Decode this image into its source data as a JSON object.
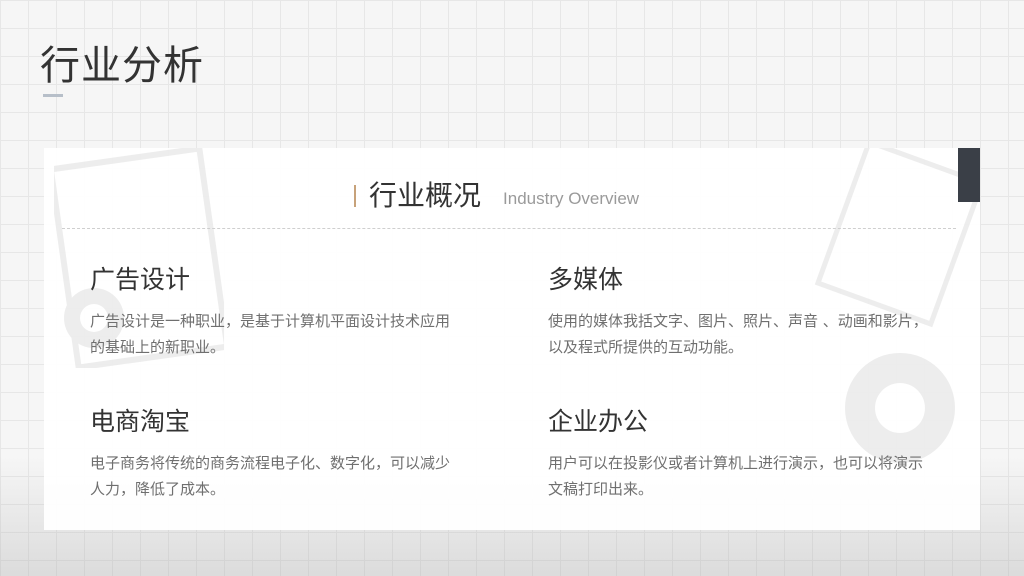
{
  "page": {
    "title": "行业分析"
  },
  "section": {
    "title": "行业概况",
    "subtitle": "Industry Overview"
  },
  "cards": [
    {
      "title": "广告设计",
      "desc": "广告设计是一种职业，是基于计算机平面设计技术应用的基础上的新职业。"
    },
    {
      "title": "多媒体",
      "desc": "使用的媒体我括文字、图片、照片、声音 、动画和影片，以及程式所提供的互动功能。"
    },
    {
      "title": "电商淘宝",
      "desc": "电子商务将传统的商务流程电子化、数字化，可以减少人力，降低了成本。"
    },
    {
      "title": "企业办公",
      "desc": "用户可以在投影仪或者计算机上进行演示，也可以将演示文稿打印出来。"
    }
  ],
  "theme": {
    "accent_bar": "#c7a27a",
    "dark_tab": "#3a3f47",
    "title_text": "#333333",
    "body_text": "#6f6f6f"
  }
}
